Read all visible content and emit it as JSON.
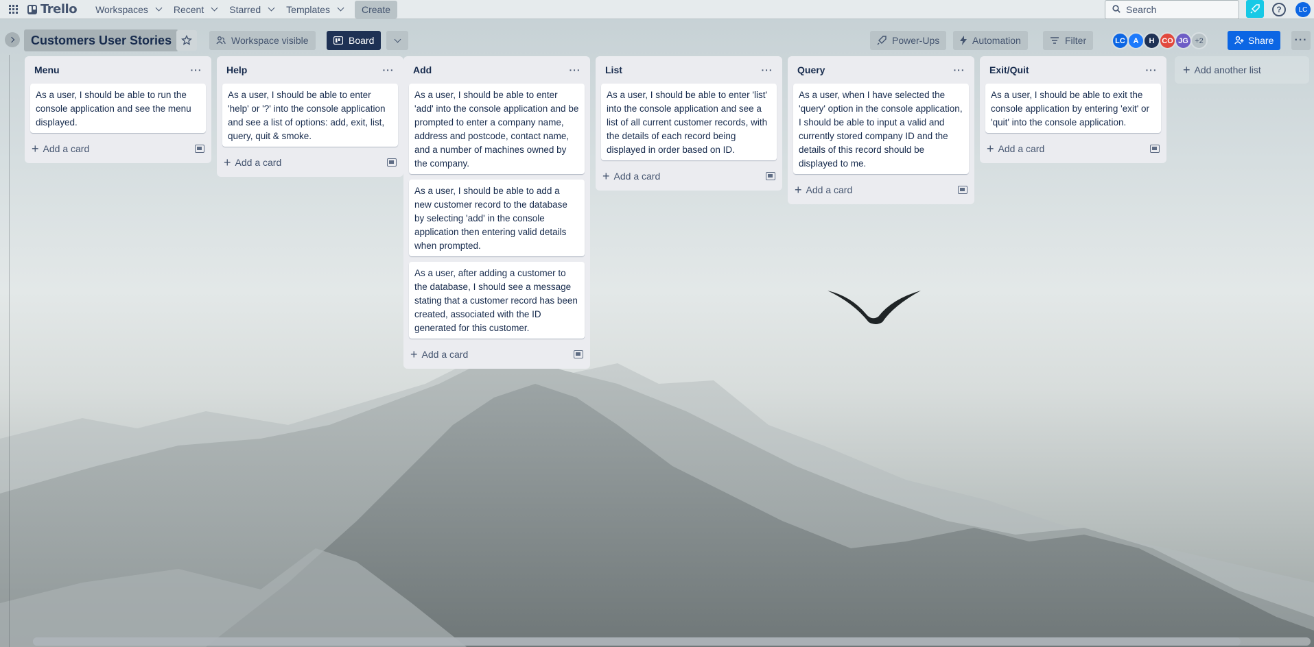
{
  "topbar": {
    "logo": "Trello",
    "menus": [
      {
        "label": "Workspaces"
      },
      {
        "label": "Recent"
      },
      {
        "label": "Starred"
      },
      {
        "label": "Templates"
      }
    ],
    "create_label": "Create",
    "search_placeholder": "Search",
    "help_symbol": "?",
    "user_initials": "LC"
  },
  "board": {
    "title": "Customers User Stories",
    "visibility_label": "Workspace visible",
    "view_label": "Board",
    "powerups_label": "Power-Ups",
    "automation_label": "Automation",
    "filter_label": "Filter",
    "share_label": "Share",
    "more_symbol": "···",
    "members": [
      {
        "initials": "LC",
        "color": "#0c66e4"
      },
      {
        "initials": "A",
        "color": "#1d7afc"
      },
      {
        "initials": "H",
        "color": "#1e3154"
      },
      {
        "initials": "CO",
        "color": "#e2483d"
      },
      {
        "initials": "JG",
        "color": "#6e5dc6"
      }
    ],
    "members_more": "+2"
  },
  "lists": [
    {
      "title": "Menu",
      "cards": [
        "As a user, I should be able to run the console application and see the menu displayed."
      ],
      "add_label": "Add a card"
    },
    {
      "title": "Help",
      "cards": [
        "As a user, I should be able to enter 'help' or '?' into the console application and see a list of options: add, exit, list, query, quit & smoke."
      ],
      "add_label": "Add a card"
    },
    {
      "title": "Add",
      "cards": [
        "As a user, I should be able to enter 'add' into the console application and be prompted to enter a company name, address and postcode, contact name, and a number of machines owned by the company.",
        "As a user, I should be able to add a new customer record to the database by selecting 'add' in the console application then entering valid details when prompted.",
        "As a user, after adding a customer to the database, I should see a message stating that a customer record has been created, associated with the ID generated for this customer."
      ],
      "add_label": "Add a card"
    },
    {
      "title": "List",
      "cards": [
        "As a user, I should be able to enter 'list' into the console application and see a list of all current customer records, with the details of each record being displayed in order based on ID."
      ],
      "add_label": "Add a card"
    },
    {
      "title": "Query",
      "cards": [
        "As a user, when I have selected the 'query' option in the console application, I should be able to input a valid and currently stored company ID and the details of this record should be displayed to me."
      ],
      "add_label": "Add a card"
    },
    {
      "title": "Exit/Quit",
      "cards": [
        "As a user, I should be able to exit the console application by entering 'exit' or 'quit' into the console application."
      ],
      "add_label": "Add a card"
    }
  ],
  "add_list_label": "Add another list",
  "list_menu_symbol": "···",
  "plus_symbol": "+"
}
